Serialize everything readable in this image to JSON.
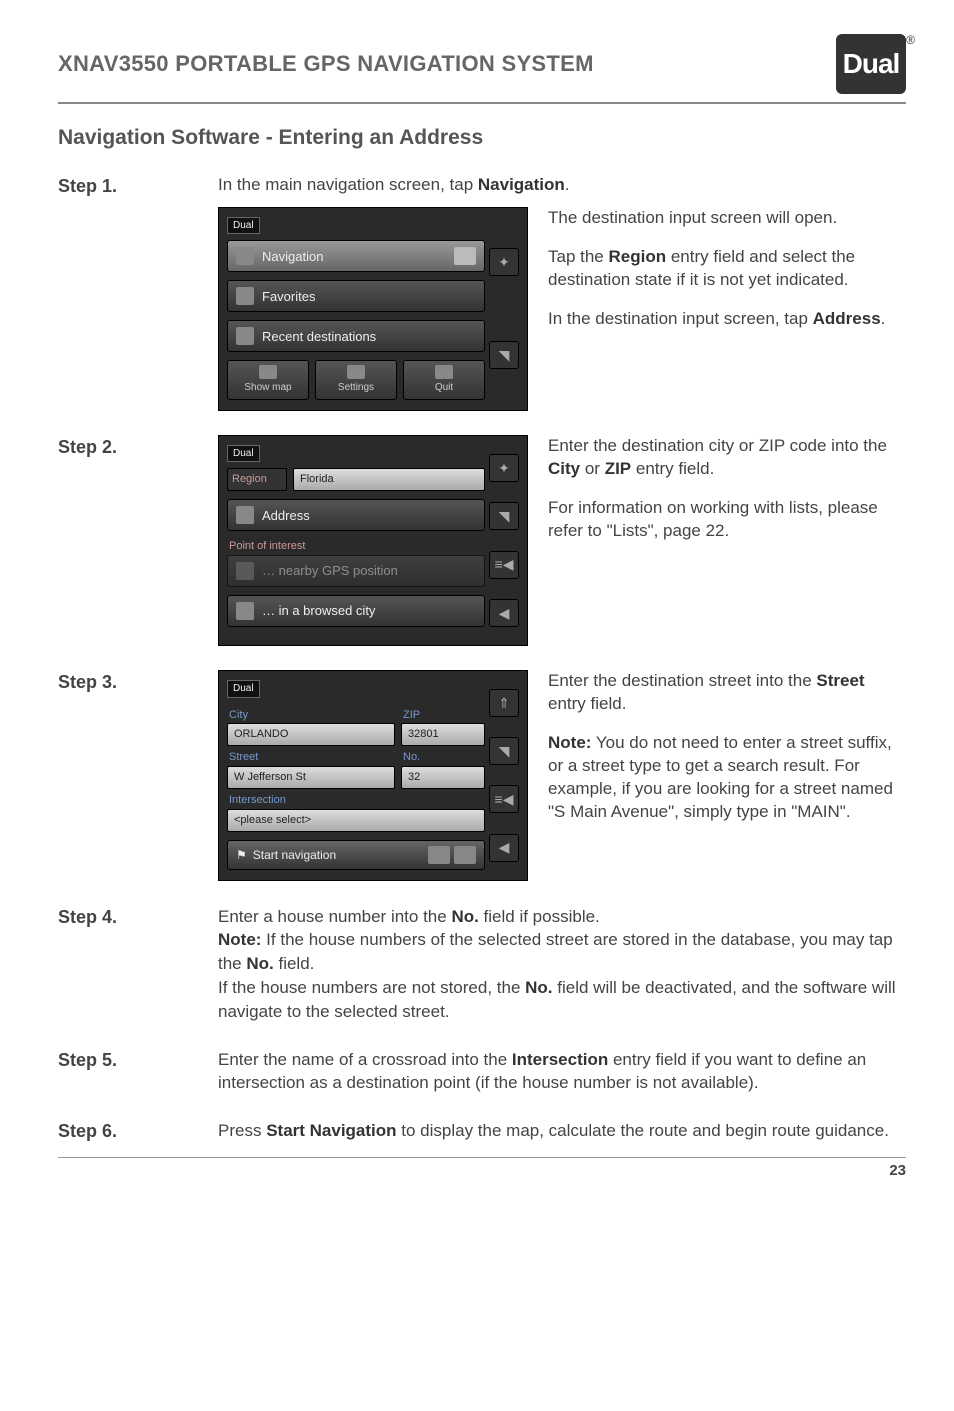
{
  "header": {
    "model": "XNAV3550",
    "product": "PORTABLE GPS NAVIGATION SYSTEM",
    "logo": "Dual"
  },
  "section_title": "Navigation Software - Entering an Address",
  "steps": {
    "s1": {
      "label": "Step 1.",
      "intro_a": "In the main navigation screen, tap ",
      "intro_b": "Navigation",
      "intro_c": ".",
      "ss": {
        "tag": "Dual",
        "nav": "Navigation",
        "fav": "Favorites",
        "recent": "Recent destinations",
        "showmap": "Show map",
        "settings": "Settings",
        "quit": "Quit"
      },
      "p1": "The destination input screen will open.",
      "p2a": "Tap the ",
      "p2b": "Region",
      "p2c": " entry field and select the destination state if it is not yet indicated.",
      "p3a": "In the destination input screen, tap ",
      "p3b": "Address",
      "p3c": "."
    },
    "s2": {
      "label": "Step 2.",
      "ss": {
        "tag": "Dual",
        "region_lbl": "Region",
        "region_val": "Florida",
        "address": "Address",
        "poi": "Point of interest",
        "nearby": "… nearby GPS position",
        "browsed": "… in a browsed city"
      },
      "p1a": "Enter the destination city or ZIP code into the ",
      "p1b": "City",
      "p1c": " or ",
      "p1d": "ZIP",
      "p1e": " entry field.",
      "p2": "For information on working with lists, please refer to \"Lists\", page 22."
    },
    "s3": {
      "label": "Step 3.",
      "ss": {
        "tag": "Dual",
        "city_lbl": "City",
        "city_val": "ORLANDO",
        "zip_lbl": "ZIP",
        "zip_val": "32801",
        "street_lbl": "Street",
        "street_val": "W Jefferson St",
        "no_lbl": "No.",
        "no_val": "32",
        "inter_lbl": "Intersection",
        "inter_val": "<please select>",
        "start": "Start navigation"
      },
      "p1a": "Enter the destination street into the ",
      "p1b": "Street",
      "p1c": " entry field.",
      "p2a": "Note:",
      "p2b": " You do not need to enter a street suffix, or a street type to get a search result. For example, if you are looking for a street named \"S Main Avenue\", simply type in \"MAIN\"."
    },
    "s4": {
      "label": "Step 4.",
      "l1a": "Enter a house number into the ",
      "l1b": "No.",
      "l1c": " field if possible.",
      "l2a": "Note:",
      "l2b": " If the house numbers of the selected street are stored in the database, you may tap the ",
      "l2c": "No.",
      "l2d": " field.",
      "l3a": "If the house numbers are not stored, the ",
      "l3b": "No.",
      "l3c": " field will be deactivated, and the software will navigate to the selected street."
    },
    "s5": {
      "label": "Step 5.",
      "t1a": "Enter the name of a crossroad into the ",
      "t1b": "Intersection",
      "t1c": " entry field if you want to define an intersection as a destination point (if the house number is not available)."
    },
    "s6": {
      "label": "Step 6.",
      "t1a": "Press ",
      "t1b": "Start Navigation",
      "t1c": " to display the map, calculate the route and begin route guidance."
    }
  },
  "page_number": "23"
}
